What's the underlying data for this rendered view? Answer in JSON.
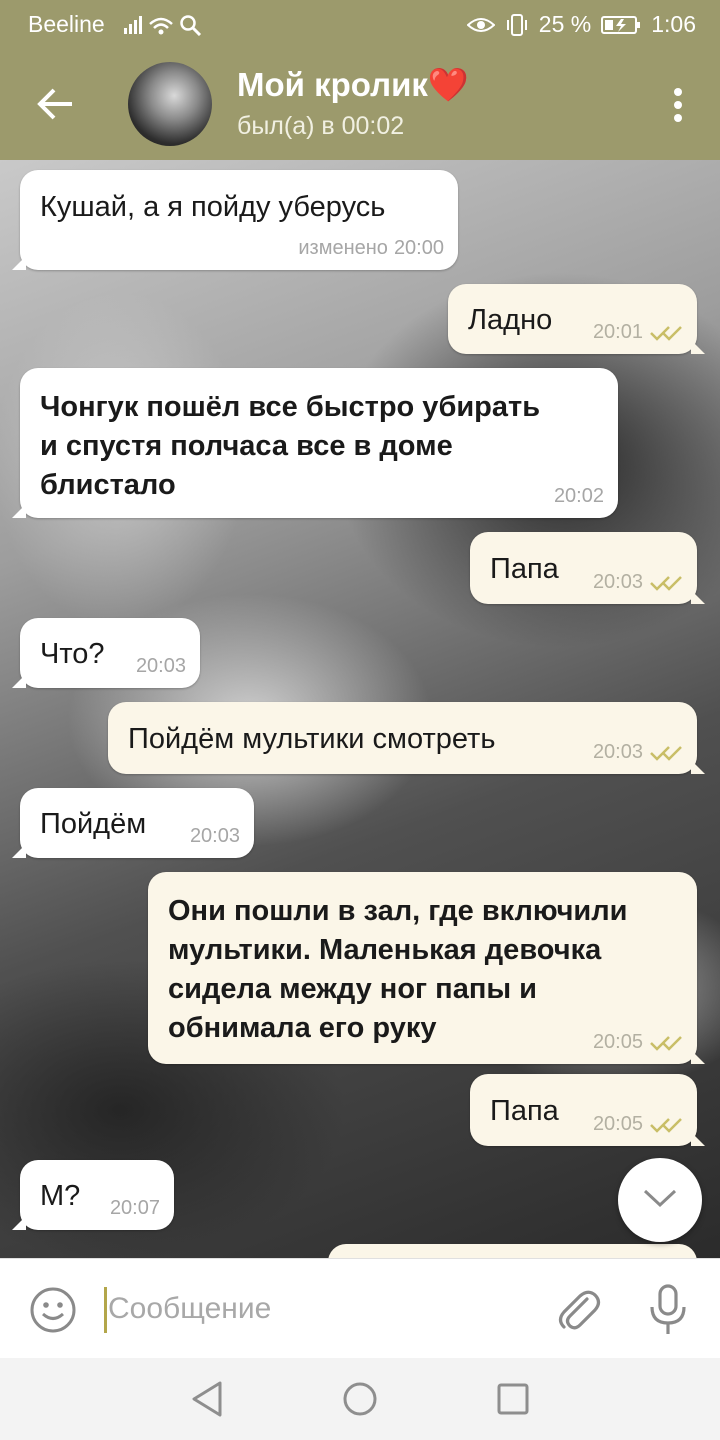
{
  "status_bar": {
    "carrier": "Beeline",
    "battery": "25 %",
    "time": "1:06"
  },
  "header": {
    "contact_name": "Мой кролик",
    "heart": "❤️",
    "last_seen": "был(а) в 00:02"
  },
  "messages": [
    {
      "dir": "in",
      "text": "Кушай, а я пойду уберусь",
      "edited": "изменено",
      "time": "20:00"
    },
    {
      "dir": "out",
      "text": "Ладно",
      "time": "20:01"
    },
    {
      "dir": "in",
      "lines": [
        "Чонгук пошёл все быстро убирать",
        "и спустя полчаса все в доме",
        "блистало"
      ],
      "time": "20:02"
    },
    {
      "dir": "out",
      "text": "Папа",
      "time": "20:03"
    },
    {
      "dir": "in",
      "text": "Что?",
      "time": "20:03"
    },
    {
      "dir": "out",
      "text": "Пойдём мультики смотреть",
      "time": "20:03"
    },
    {
      "dir": "in",
      "text": "Пойдём",
      "time": "20:03"
    },
    {
      "dir": "out",
      "lines": [
        "Они пошли в зал, где включили",
        "мультики. Маленькая девочка",
        "сидела между ног папы и",
        "обнимала его руку"
      ],
      "time": "20:05"
    },
    {
      "dir": "out",
      "text": "Папа",
      "time": "20:05"
    },
    {
      "dir": "in",
      "text": "М?",
      "time": "20:07"
    }
  ],
  "composer": {
    "placeholder": "Сообщение"
  },
  "colors": {
    "header": "#9c9a6c",
    "outgoing_bubble": "#fbf6e8",
    "incoming_bubble": "#ffffff",
    "read_ticks": "#c9be67"
  }
}
